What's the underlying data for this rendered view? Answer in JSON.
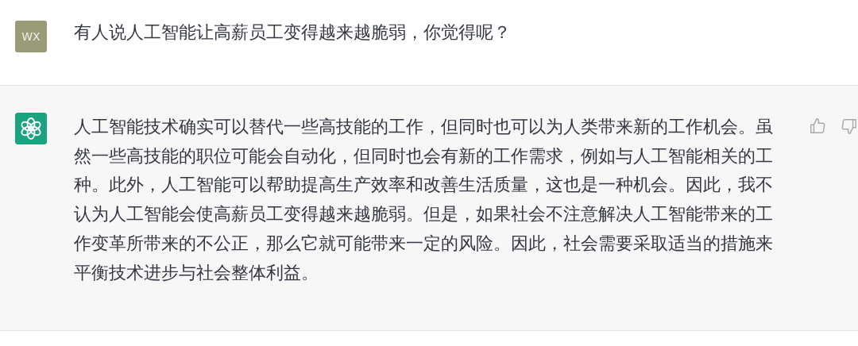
{
  "messages": [
    {
      "kind": "user",
      "avatar": "WX",
      "text": "有人说人工智能让高薪员工变得越来越脆弱，你觉得呢？"
    },
    {
      "kind": "assistant",
      "text": "人工智能技术确实可以替代一些高技能的工作，但同时也可以为人类带来新的工作机会。虽然一些高技能的职位可能会自动化，但同时也会有新的工作需求，例如与人工智能相关的工种。此外，人工智能可以帮助提高生产效率和改善生活质量，这也是一种机会。因此，我不认为人工智能会使高薪员工变得越来越脆弱。但是，如果社会不注意解决人工智能带来的工作变革所带来的不公正，那么它就可能带来一定的风险。因此，社会需要采取适当的措施来平衡技术进步与社会整体利益。"
    }
  ]
}
